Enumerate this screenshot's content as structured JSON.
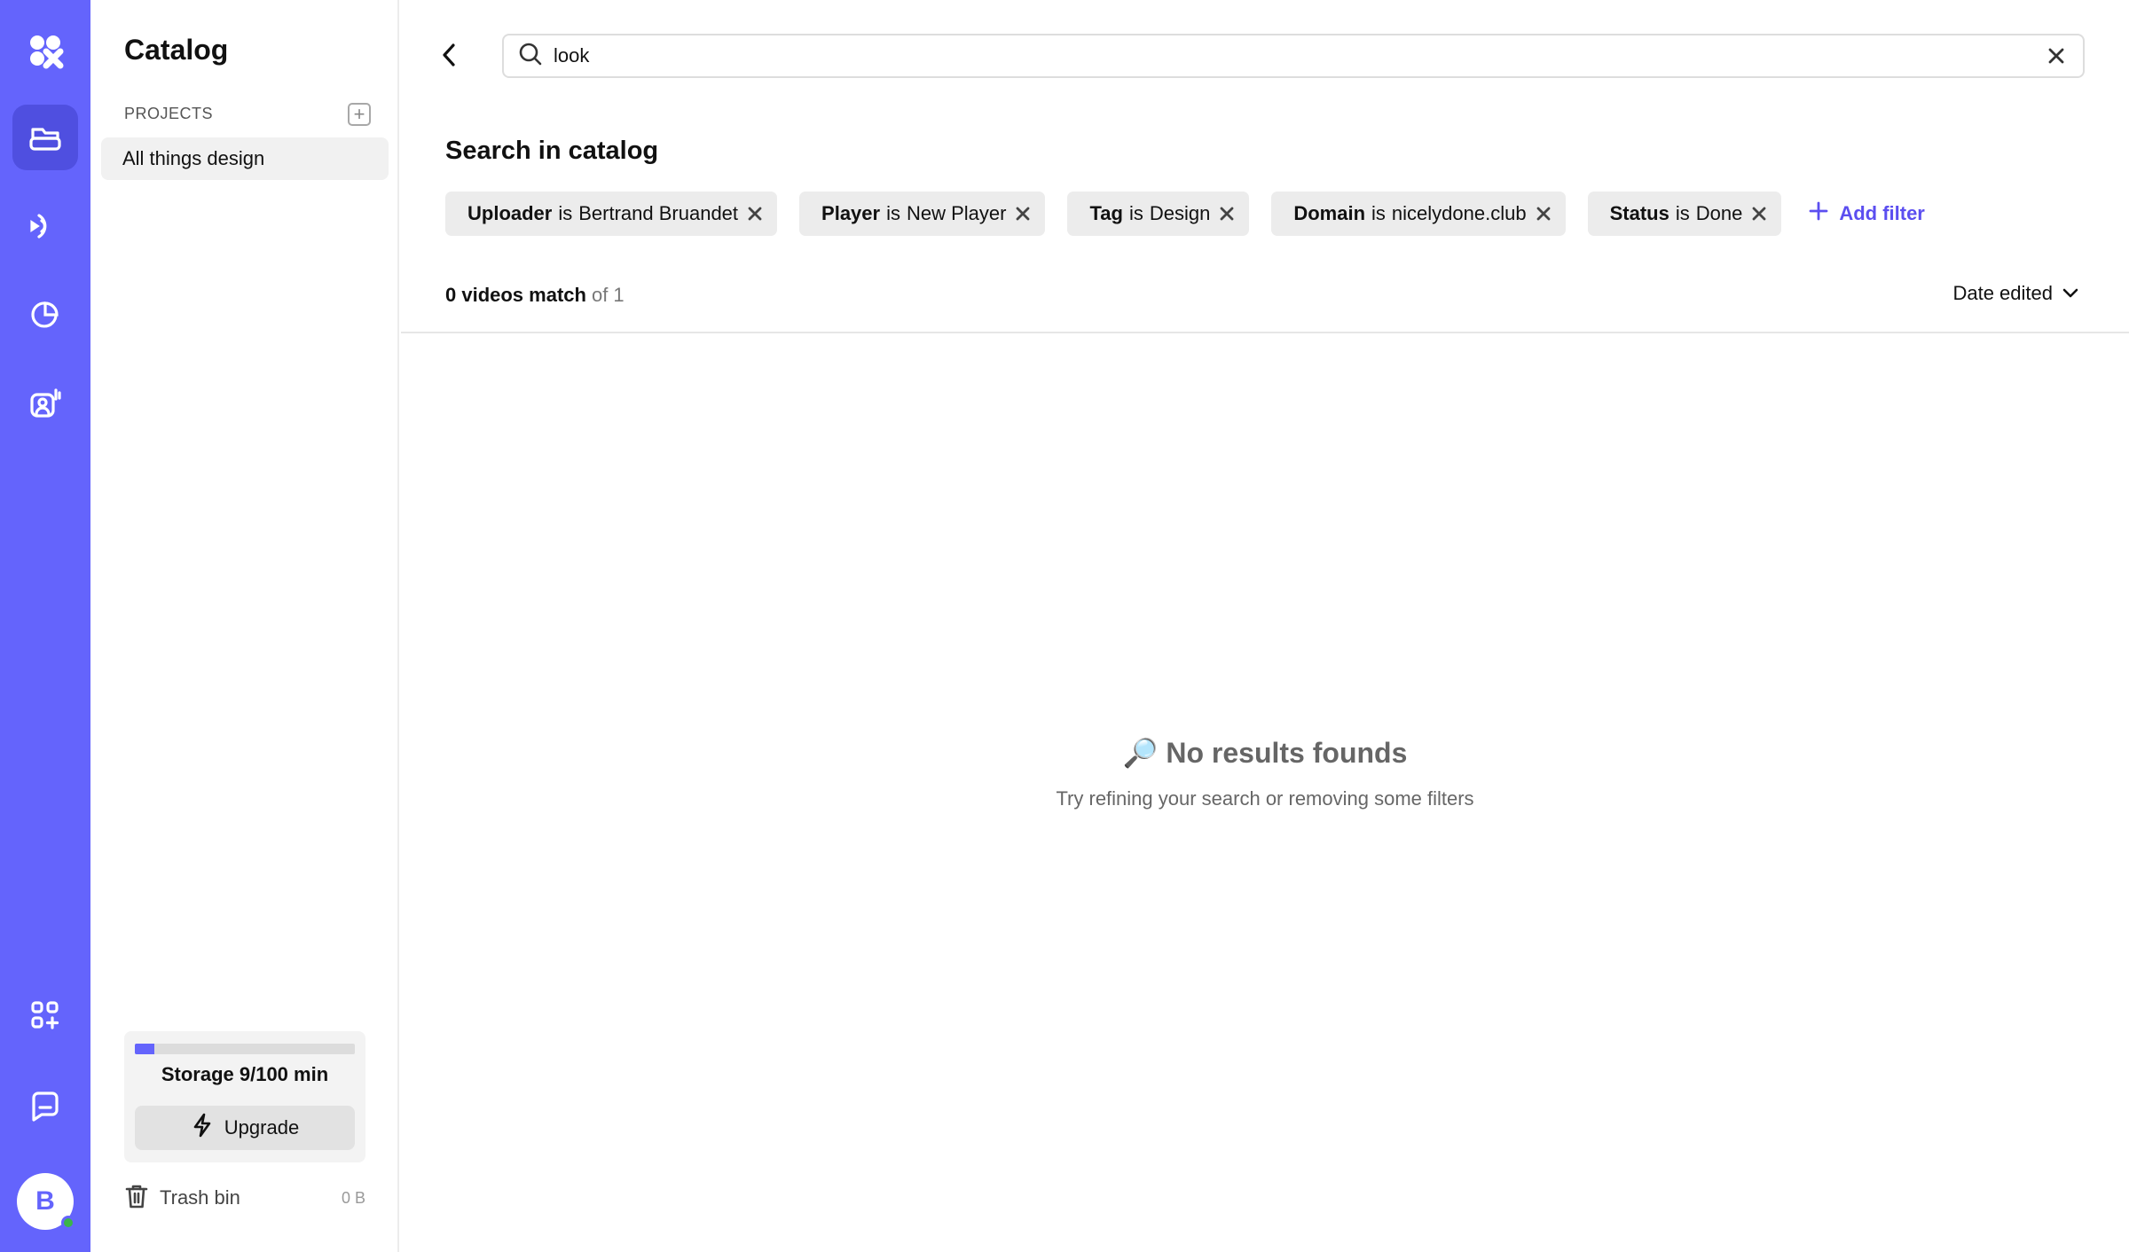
{
  "app": {
    "name": "Catalog",
    "avatar_initial": "B"
  },
  "colors": {
    "brand": "#6464fc",
    "accent_text": "#5b4ef0",
    "chip_bg": "#ececec",
    "online": "#3bb54a"
  },
  "rail": {
    "items": [
      {
        "icon": "logo-icon",
        "active": false
      },
      {
        "icon": "catalog-icon",
        "active": true
      },
      {
        "icon": "broadcast-icon",
        "active": false
      },
      {
        "icon": "analytics-icon",
        "active": false
      },
      {
        "icon": "audience-icon",
        "active": false
      },
      {
        "icon": "apps-icon",
        "active": false
      },
      {
        "icon": "chat-icon",
        "active": false
      }
    ]
  },
  "sidebar": {
    "title": "Catalog",
    "projects_label": "PROJECTS",
    "projects": [
      {
        "label": "All things design"
      }
    ],
    "storage": {
      "label": "Storage 9/100 min",
      "used_fraction": 0.09
    },
    "upgrade_label": "Upgrade",
    "trash": {
      "label": "Trash bin",
      "size": "0 B"
    }
  },
  "search": {
    "value": "look",
    "placeholder": ""
  },
  "main": {
    "section_title": "Search in catalog",
    "filters": [
      {
        "key": "Uploader",
        "op": "is",
        "value": "Bertrand Bruandet"
      },
      {
        "key": "Player",
        "op": "is",
        "value": "New Player"
      },
      {
        "key": "Tag",
        "op": "is",
        "value": "Design"
      },
      {
        "key": "Domain",
        "op": "is",
        "value": "nicelydone.club"
      },
      {
        "key": "Status",
        "op": "is",
        "value": "Done"
      }
    ],
    "add_filter_label": "Add filter",
    "match_count": "0 videos match",
    "match_total": "of 1",
    "sort_label": "Date edited",
    "empty_emoji": "🔎",
    "empty_title": "No results founds",
    "empty_subtitle": "Try refining your search or removing some filters"
  }
}
